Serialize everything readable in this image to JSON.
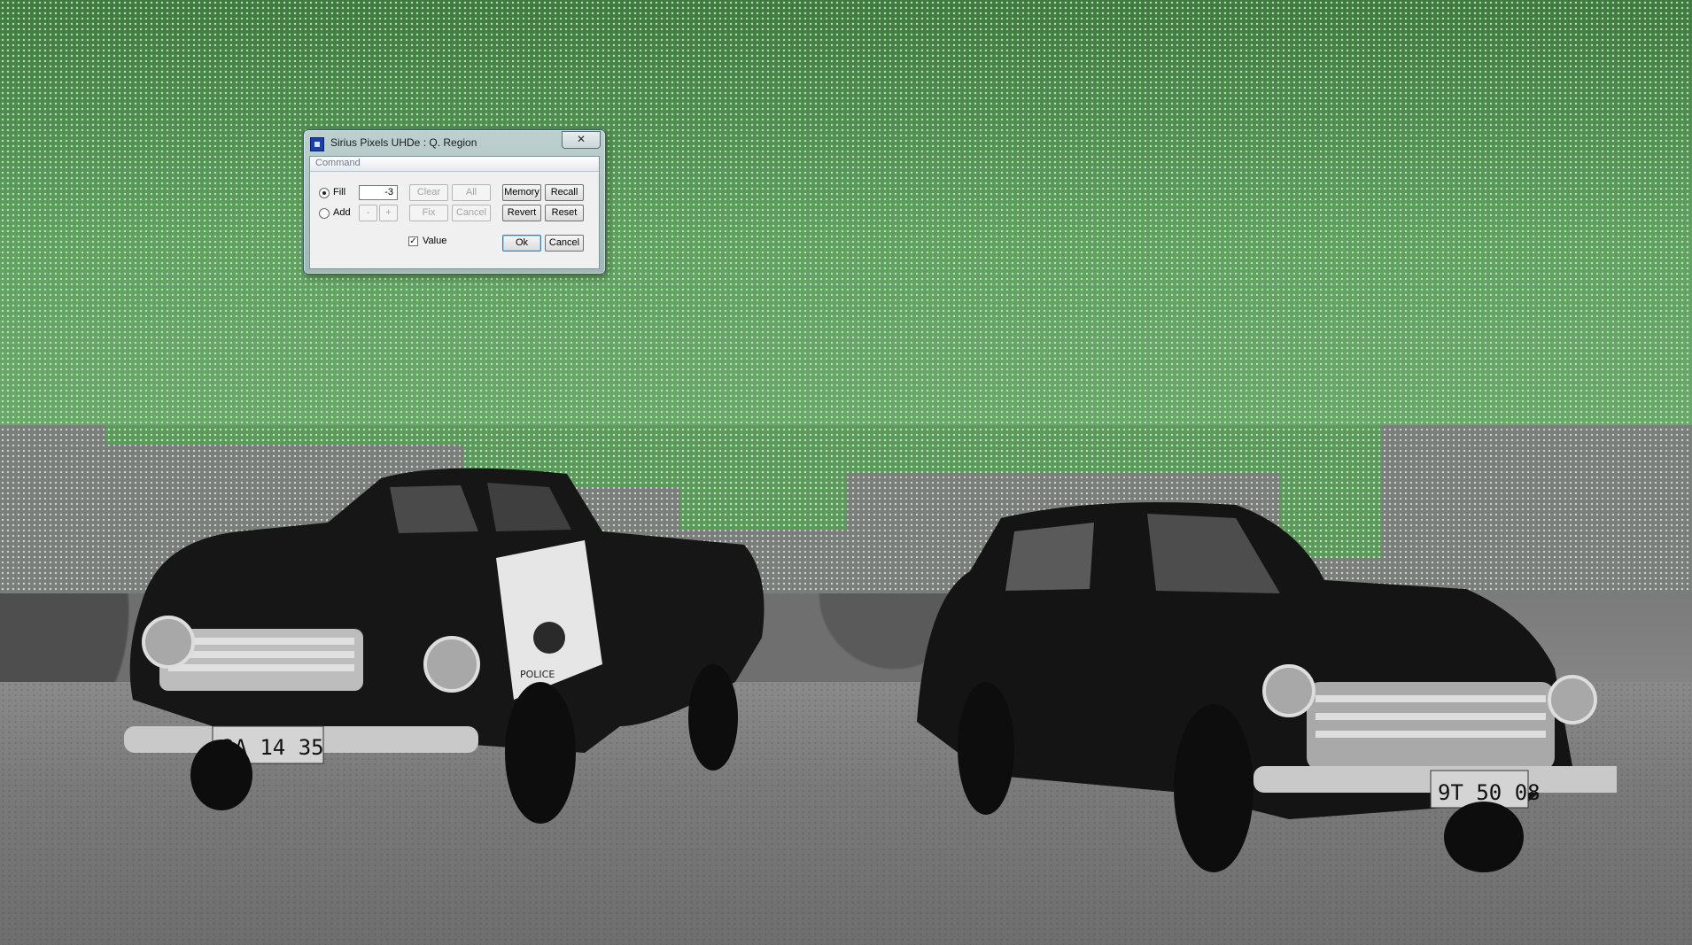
{
  "dialog": {
    "title": "Sirius Pixels UHDe : Q.  Region",
    "close_symbol": "✕",
    "group_title": "Command",
    "fill_label": "Fill",
    "add_label": "Add",
    "fill_value": "-3",
    "mode_selected": "Fill",
    "buttons": {
      "clear": "Clear",
      "all": "All",
      "minus": "-",
      "plus": "+",
      "fix": "Fix",
      "cancel_small": "Cancel",
      "memory": "Memory",
      "recall": "Recall",
      "revert": "Revert",
      "reset": "Reset",
      "ok": "Ok",
      "cancel": "Cancel"
    },
    "value_label": "Value",
    "value_checked": true
  },
  "background": {
    "left_plate": "2A 14 35",
    "right_plate": "9T 50 08",
    "police_text": "POLICE",
    "overlay_color": "#5c9a5c"
  },
  "icons": {
    "app": "app-icon",
    "close": "close-icon"
  }
}
